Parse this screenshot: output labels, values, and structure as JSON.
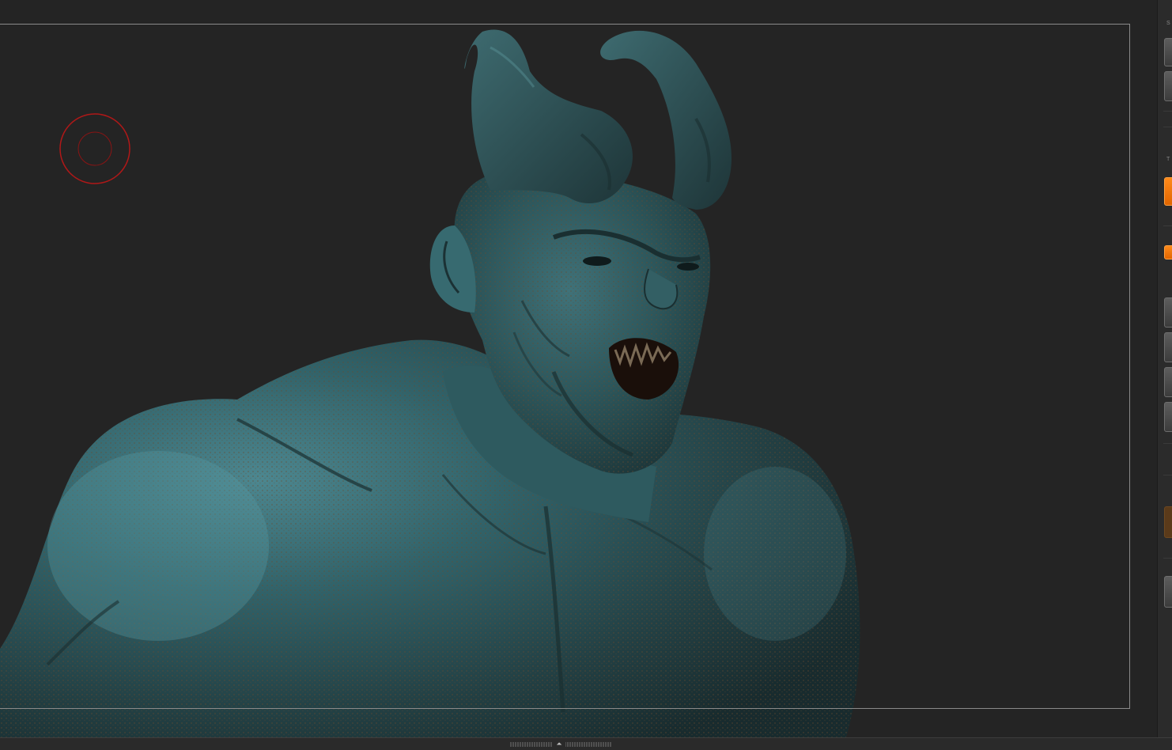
{
  "viewport": {
    "background": "#242424",
    "frame_color": "#8a8a8a",
    "model": "horned-demon-bust-sculpt",
    "material_color": "#2f6268",
    "cavity_color": "#6b4a2e"
  },
  "brush_cursor": {
    "color": "#b01818"
  },
  "right_shelf": {
    "labels": [
      "S",
      "T"
    ],
    "accent": "#ff7a00"
  },
  "bottom_bar": {
    "collapse_icon": "chevron-up-icon",
    "collapse_glyph": "⏶"
  }
}
